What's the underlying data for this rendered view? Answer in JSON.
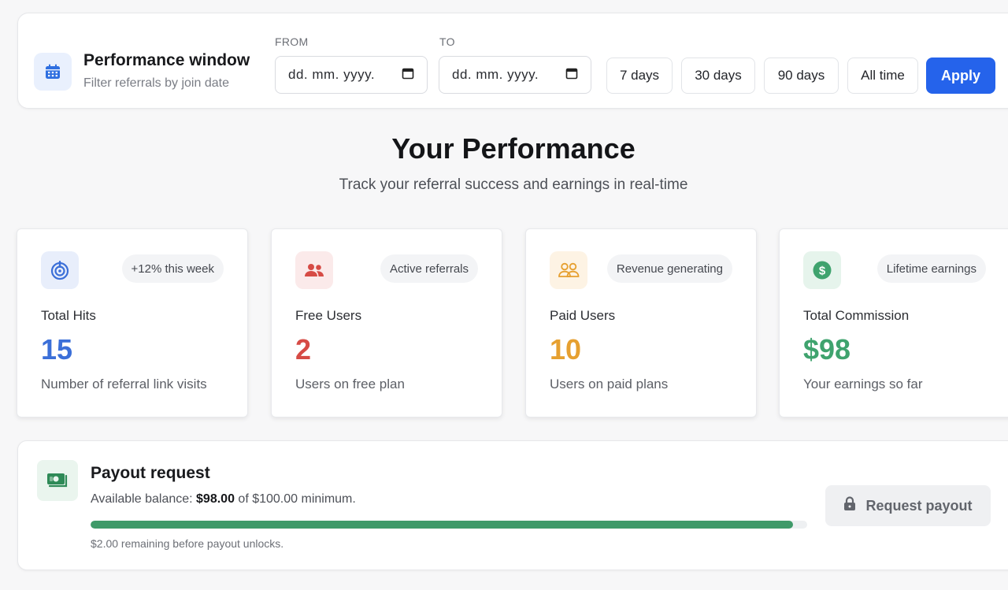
{
  "filter": {
    "title": "Performance window",
    "subtitle": "Filter referrals by join date",
    "from_label": "FROM",
    "to_label": "TO",
    "from_value": "dd. mm. yyyy.",
    "to_value": "dd. mm. yyyy.",
    "ranges": [
      "7 days",
      "30 days",
      "90 days",
      "All time"
    ],
    "apply_label": "Apply"
  },
  "header": {
    "title": "Your Performance",
    "subtitle": "Track your referral success and earnings in real-time"
  },
  "stats": [
    {
      "badge": "+12% this week",
      "label": "Total Hits",
      "value": "15",
      "desc": "Number of referral link visits",
      "icon": "target-icon",
      "color": "#3b6fd8"
    },
    {
      "badge": "Active referrals",
      "label": "Free Users",
      "value": "2",
      "desc": "Users on free plan",
      "icon": "users-icon",
      "color": "#d64b45"
    },
    {
      "badge": "Revenue generating",
      "label": "Paid Users",
      "value": "10",
      "desc": "Users on paid plans",
      "icon": "paid-users-icon",
      "color": "#e6a030"
    },
    {
      "badge": "Lifetime earnings",
      "label": "Total Commission",
      "value": "$98",
      "desc": "Your earnings so far",
      "icon": "dollar-icon",
      "color": "#3fa36e"
    }
  ],
  "payout": {
    "title": "Payout request",
    "balance_prefix": "Available balance: ",
    "balance_amount": "$98.00",
    "balance_suffix": " of $100.00 minimum.",
    "progress": 0.98,
    "note": "$2.00 remaining before payout unlocks.",
    "button_label": "Request payout",
    "button_icon": "lock-icon"
  }
}
